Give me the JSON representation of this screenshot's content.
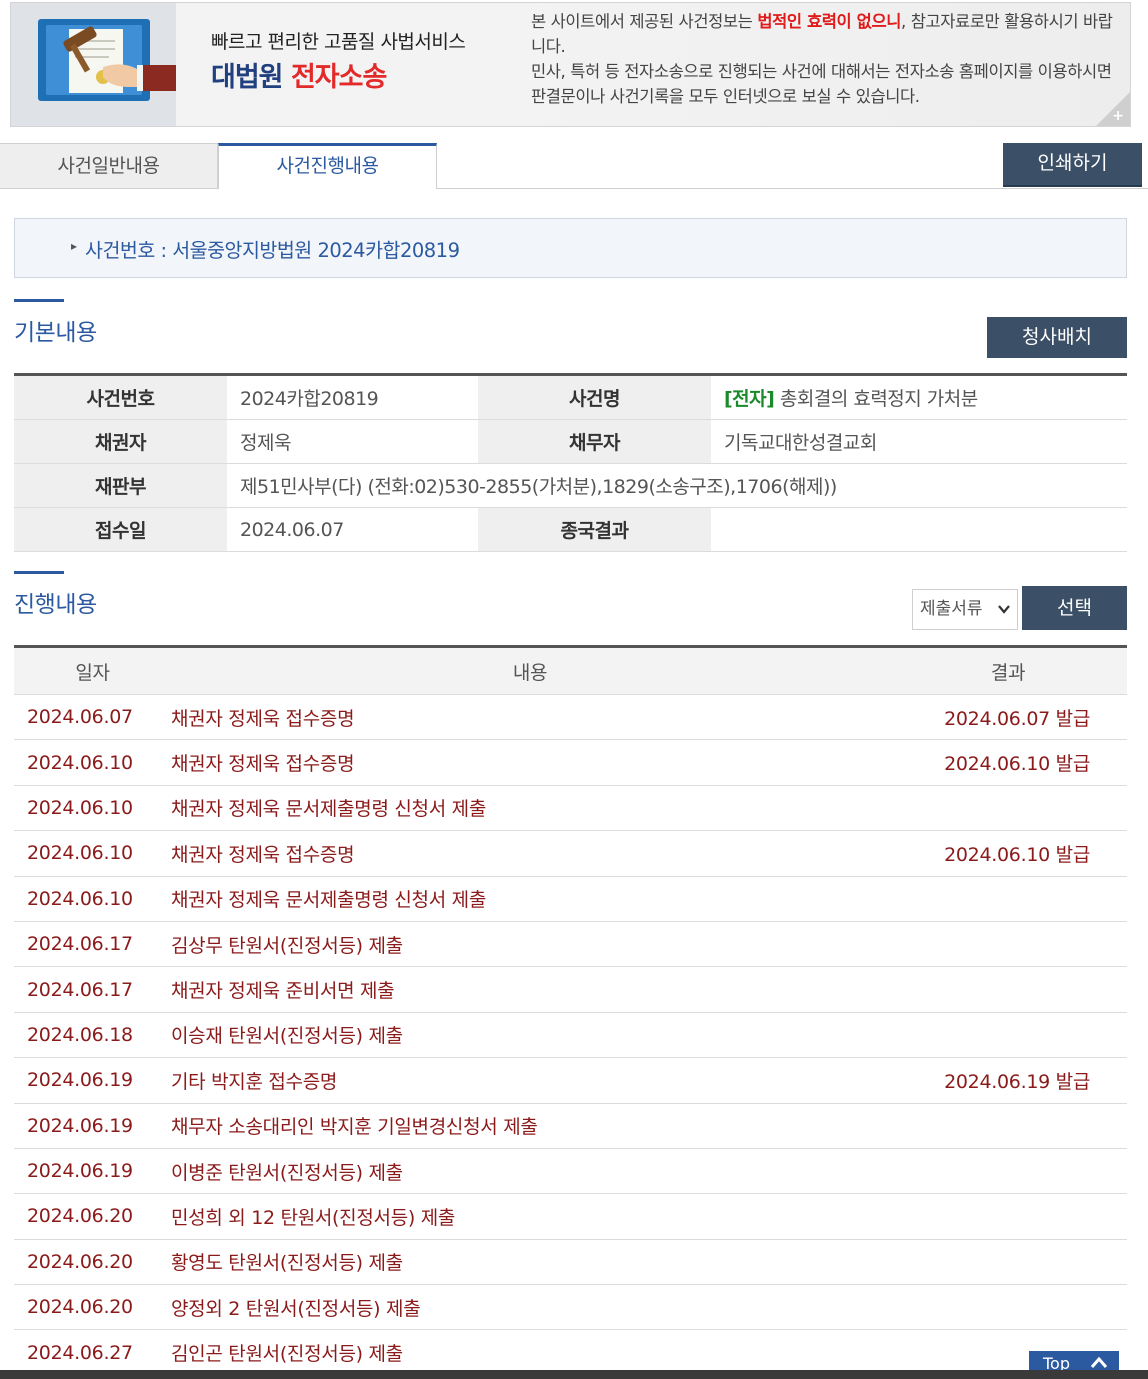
{
  "banner": {
    "slogan": "빠르고 편리한 고품질 사법서비스",
    "brand_navy": "대법원",
    "brand_red": "전자소송",
    "notice_prefix": "본 사이트에서 제공된 사건정보는 ",
    "notice_emphasis": "법적인 효력이 없으니",
    "notice_mid": ", 참고자료로만 활용하시기 바랍니다.",
    "notice_line2": "민사, 특허 등 전자소송으로 진행되는 사건에 대해서는 전자소송 홈페이지를 이용하시면 판결문이나 사건기록을 모두 인터넷으로 보실 수 있습니다.",
    "corner_plus": "+"
  },
  "tabs": [
    {
      "label": "사건일반내용",
      "active": false
    },
    {
      "label": "사건진행내용",
      "active": true
    }
  ],
  "print_label": "인쇄하기",
  "case_number_line": "사건번호 : 서울중앙지방법원 2024카합20819",
  "basic": {
    "title": "기본내용",
    "courtroom_button": "청사배치",
    "rows": [
      {
        "h1": "사건번호",
        "v1": "2024카합20819",
        "h2": "사건명",
        "v2_tag": "[전자]",
        "v2": "총회결의 효력정지 가처분"
      },
      {
        "h1": "채권자",
        "v1": "정제욱",
        "h2": "채무자",
        "v2_tag": "",
        "v2": "기독교대한성결교회"
      },
      {
        "h1": "재판부",
        "v1": "제51민사부(다) (전화:02)530-2855(가처분),1829(소송구조),1706(해제))"
      },
      {
        "h1": "접수일",
        "v1": "2024.06.07",
        "h2": "종국결과",
        "v2_tag": "",
        "v2": ""
      }
    ]
  },
  "progress": {
    "title": "진행내용",
    "filter_value": "제출서류",
    "select_button": "선택",
    "headers": {
      "date": "일자",
      "content": "내용",
      "result": "결과"
    },
    "rows": [
      {
        "date": "2024.06.07",
        "content": "채권자 정제욱 접수증명",
        "result": "2024.06.07 발급"
      },
      {
        "date": "2024.06.10",
        "content": "채권자 정제욱 접수증명",
        "result": "2024.06.10 발급"
      },
      {
        "date": "2024.06.10",
        "content": "채권자 정제욱 문서제출명령 신청서 제출",
        "result": ""
      },
      {
        "date": "2024.06.10",
        "content": "채권자 정제욱 접수증명",
        "result": "2024.06.10 발급"
      },
      {
        "date": "2024.06.10",
        "content": "채권자 정제욱 문서제출명령 신청서 제출",
        "result": ""
      },
      {
        "date": "2024.06.17",
        "content": "김상무 탄원서(진정서등) 제출",
        "result": ""
      },
      {
        "date": "2024.06.17",
        "content": "채권자 정제욱 준비서면 제출",
        "result": ""
      },
      {
        "date": "2024.06.18",
        "content": "이승재 탄원서(진정서등) 제출",
        "result": ""
      },
      {
        "date": "2024.06.19",
        "content": "기타 박지훈 접수증명",
        "result": "2024.06.19 발급"
      },
      {
        "date": "2024.06.19",
        "content": "채무자 소송대리인 박지훈 기일변경신청서 제출",
        "result": ""
      },
      {
        "date": "2024.06.19",
        "content": "이병준 탄원서(진정서등) 제출",
        "result": ""
      },
      {
        "date": "2024.06.20",
        "content": "민성희 외 12 탄원서(진정서등) 제출",
        "result": ""
      },
      {
        "date": "2024.06.20",
        "content": "황영도 탄원서(진정서등) 제출",
        "result": ""
      },
      {
        "date": "2024.06.20",
        "content": "양정외 2 탄원서(진정서등) 제출",
        "result": ""
      },
      {
        "date": "2024.06.27",
        "content": "김인곤 탄원서(진정서등) 제출",
        "result": ""
      }
    ]
  },
  "top_label": "Top",
  "colors": {
    "accent_blue": "#2c5aa0",
    "button_dark": "#3b4f66",
    "row_text": "#8b1a1a",
    "tag_green": "#1a8a2a",
    "emphasis_red": "#e01b1b"
  },
  "icons": [
    "gavel-document-icon",
    "chevron-down-icon",
    "chevron-up-icon",
    "bullet-icon"
  ]
}
